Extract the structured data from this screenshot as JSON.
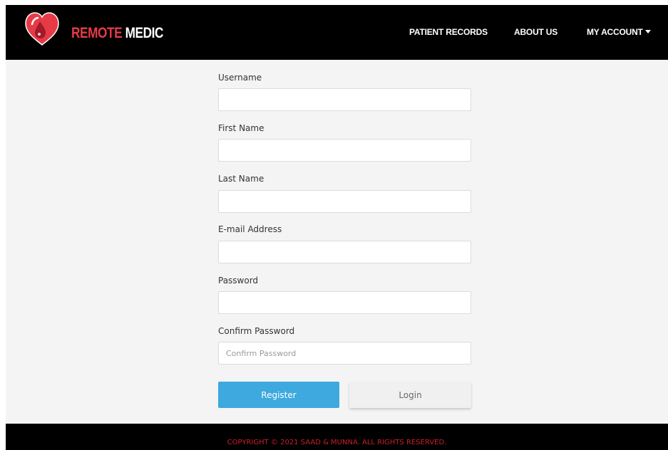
{
  "brand": {
    "part1": "REMOTE",
    "part2": "MEDIC"
  },
  "nav": {
    "patient_records": "PATIENT RECORDS",
    "about_us": "ABOUT US",
    "my_account": "MY ACCOUNT"
  },
  "form": {
    "username": {
      "label": "Username",
      "value": "",
      "placeholder": ""
    },
    "first_name": {
      "label": "First Name",
      "value": "",
      "placeholder": ""
    },
    "last_name": {
      "label": "Last Name",
      "value": "",
      "placeholder": ""
    },
    "email": {
      "label": "E-mail Address",
      "value": "",
      "placeholder": ""
    },
    "password": {
      "label": "Password",
      "value": "",
      "placeholder": ""
    },
    "confirm_password": {
      "label": "Confirm Password",
      "value": "",
      "placeholder": "Confirm Password"
    },
    "register_label": "Register",
    "login_label": "Login"
  },
  "footer": {
    "text": "COPYRIGHT © 2021 SAAD & MUNNA. ALL RIGHTS RESERVED."
  },
  "colors": {
    "brand_red": "#e63b47",
    "primary_blue": "#3da9de",
    "footer_red": "#c8202d",
    "nav_bg": "#000000",
    "page_bg": "#f4f4f4"
  }
}
